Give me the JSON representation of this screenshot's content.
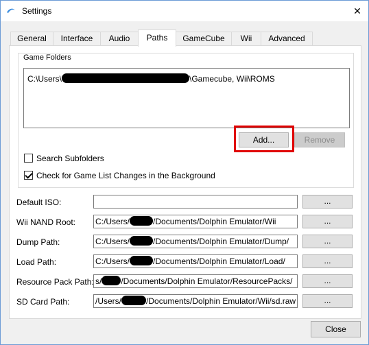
{
  "window": {
    "title": "Settings",
    "close_glyph": "✕",
    "icon": "dolphin-icon"
  },
  "tabs": [
    {
      "label": "General"
    },
    {
      "label": "Interface"
    },
    {
      "label": "Audio"
    },
    {
      "label": "Paths",
      "active": true
    },
    {
      "label": "GameCube"
    },
    {
      "label": "Wii"
    },
    {
      "label": "Advanced"
    }
  ],
  "game_folders": {
    "title": "Game Folders",
    "items": [
      {
        "prefix": "C:\\Users\\",
        "suffix": "\\Gamecube, Wii\\ROMS"
      }
    ],
    "add_label": "Add...",
    "remove_label": "Remove",
    "search_subfolders": {
      "label": "Search Subfolders",
      "checked": false
    },
    "check_changes": {
      "label": "Check for Game List Changes in the Background",
      "checked": true
    }
  },
  "paths": {
    "default_iso": {
      "label": "Default ISO:",
      "value": ""
    },
    "wii_nand": {
      "label": "Wii NAND Root:",
      "prefix": "C:/Users/",
      "suffix": "/Documents/Dolphin Emulator/Wii"
    },
    "dump": {
      "label": "Dump Path:",
      "prefix": "C:/Users/",
      "suffix": "/Documents/Dolphin Emulator/Dump/"
    },
    "load": {
      "label": "Load Path:",
      "prefix": "C:/Users/",
      "suffix": "/Documents/Dolphin Emulator/Load/"
    },
    "resource": {
      "label": "Resource Pack Path:",
      "prefix": "s/",
      "suffix": "/Documents/Dolphin Emulator/ResourcePacks/"
    },
    "sd_card": {
      "label": "SD Card Path:",
      "prefix": "/Users/",
      "suffix": "/Documents/Dolphin Emulator/Wii/sd.raw"
    },
    "browse_label": "..."
  },
  "footer": {
    "close_label": "Close"
  },
  "colors": {
    "highlight": "#e00000",
    "title_border": "#6b9bd6"
  }
}
